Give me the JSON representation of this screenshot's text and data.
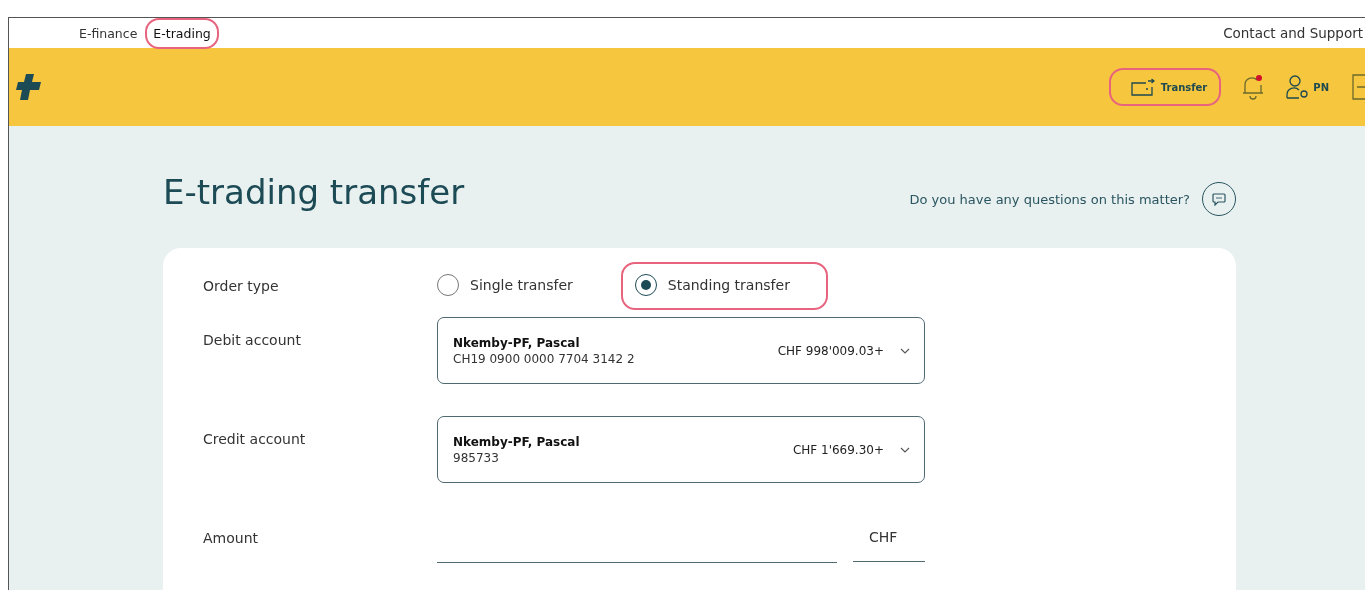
{
  "top_nav": {
    "tabs": [
      {
        "label": "E-finance",
        "selected": false,
        "highlighted": false
      },
      {
        "label": "E-trading",
        "selected": true,
        "highlighted": true
      }
    ],
    "support_link": "Contact and Support"
  },
  "header": {
    "transfer_button": {
      "label": "Transfer",
      "highlighted": true
    },
    "notifications": {
      "unread": true
    },
    "user": {
      "initials": "PN"
    }
  },
  "page": {
    "title": "E-trading transfer",
    "help_text": "Do you have any questions on this matter?"
  },
  "form": {
    "order_type": {
      "label": "Order type",
      "options": [
        {
          "label": "Single transfer",
          "selected": false,
          "highlighted": false
        },
        {
          "label": "Standing transfer",
          "selected": true,
          "highlighted": true
        }
      ]
    },
    "accounts": [
      {
        "label": "Debit account",
        "holder": "Nkemby-PF, Pascal",
        "number": "CH19 0900 0000 7704 3142 2",
        "balance": "CHF 998'009.03+"
      },
      {
        "label": "Credit account",
        "holder": "Nkemby-PF, Pascal",
        "number": "985733",
        "balance": "CHF 1'669.30+"
      }
    ],
    "amount": {
      "label": "Amount",
      "currency": "CHF"
    }
  }
}
